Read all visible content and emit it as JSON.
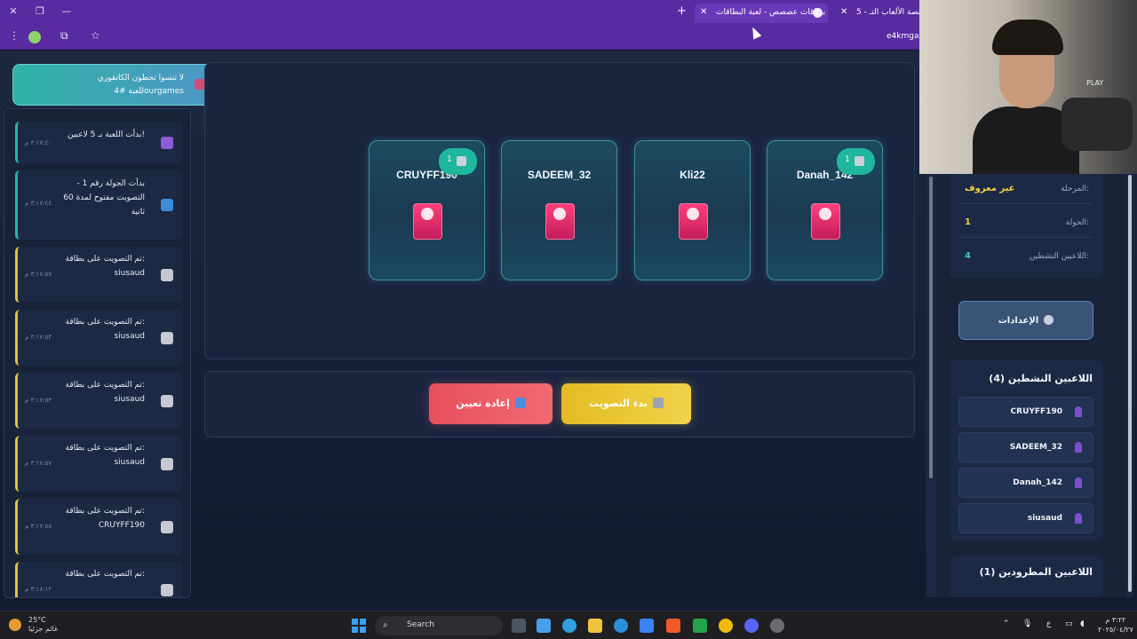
{
  "browser": {
    "tabs": [
      {
        "title": "بطاقات عصصص - لعبة البطاقات",
        "active": true
      },
      {
        "title": "5 - منصة الألعاب التـ",
        "active": false
      }
    ],
    "url": "e4kmga",
    "tab_close": "✕",
    "new_tab": "+"
  },
  "promo": {
    "line1": "لا تنسوا تحطون الكاتقوري",
    "line2": "للعبة #4ourgames"
  },
  "log": [
    {
      "type": "game",
      "text": "بدأت اللعبة بـ 5 لاعبين!",
      "time": "٣:١٧:٤٠ م"
    },
    {
      "type": "round",
      "text": "بدأت الجولة رقم 1 - التصويت مفتوح لمدة 60 ثانية",
      "time": "٣:١٧:٤٤ م"
    },
    {
      "type": "vote",
      "text": "تم التصويت على بطاقة: siusaud",
      "time": "٣:١٧:٥٧ م"
    },
    {
      "type": "vote",
      "text": "تم التصويت على بطاقة: siusaud",
      "time": "٣:١٧:٥٣ م"
    },
    {
      "type": "vote",
      "text": "تم التصويت على بطاقة: siusaud",
      "time": "٣:١٧:٥٣ م"
    },
    {
      "type": "vote",
      "text": "تم التصويت على بطاقة: siusaud",
      "time": "٣:١٧:٥٧ م"
    },
    {
      "type": "vote",
      "text": "تم التصويت على بطاقة: CRUYFF190",
      "time": "٣:١٧:٥٨ م"
    },
    {
      "type": "vote",
      "text": "تم التصويت على بطاقة:",
      "time": "٣:١٨:١٢ م"
    }
  ],
  "cards": [
    {
      "name": "CRUYFF190",
      "votes": "1",
      "has_badge": true
    },
    {
      "name": "SADEEM_32",
      "votes": "",
      "has_badge": false
    },
    {
      "name": "Kli22",
      "votes": "",
      "has_badge": false
    },
    {
      "name": "Danah_142",
      "votes": "1",
      "has_badge": true
    }
  ],
  "actions": {
    "reset_label": "إعادة تعيين",
    "start_vote_label": "بدء التصويت"
  },
  "status": {
    "stage_label": "المرحلة:",
    "stage_value": "غير معروف",
    "round_label": "الجولة:",
    "round_value": "1",
    "active_label": "اللاعبين النشطين:",
    "active_value": "4"
  },
  "settings_label": "الإعدادات",
  "active_players": {
    "title": "اللاعبين النشطين (4)",
    "players": [
      "CRUYFF190",
      "SADEEM_32",
      "Danah_142",
      "siusaud"
    ]
  },
  "kicked_players": {
    "title": "اللاعبين المطرودين (1)"
  },
  "webcam": {
    "overlay_text": "PLAY"
  },
  "taskbar": {
    "weather_temp": "25°C",
    "weather_desc": "غائم جزئيا",
    "search_placeholder": "Search",
    "lang": "ع",
    "time": "٣:٢٢ م",
    "date": "٢٠٢٥/٠٤/٢٧"
  },
  "colors": {
    "accent_teal": "#1fb79e",
    "reset_red": "#e8505f",
    "vote_yellow": "#e3bc23",
    "stage_value_yellow": "#f2d245"
  }
}
